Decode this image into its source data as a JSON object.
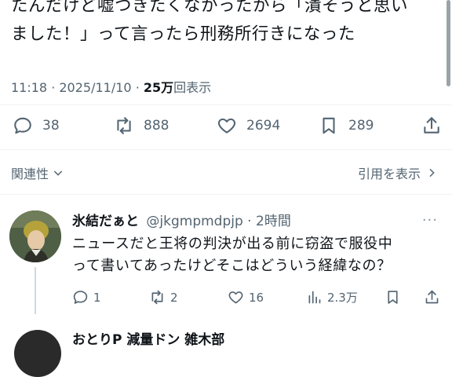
{
  "tweet": {
    "lines": [
      "たんだけど嘘つきたくなかったから「潰そうと思い",
      "ました！」って言ったら刑務所行きになった"
    ],
    "time": "11:18",
    "date": "2025/11/10",
    "views_count": "25万",
    "views_label": "回表示",
    "actions": {
      "replies": "38",
      "retweets": "888",
      "likes": "2694",
      "bookmarks": "289"
    },
    "related_label": "関連性",
    "quotes_label": "引用を表示"
  },
  "reply": {
    "display_name": "氷結だぁと",
    "handle": "@jkgmpmdpjp",
    "time_ago": "2時間",
    "lines": [
      "ニュースだと王将の判決が出る前に窃盗で服役中",
      "って書いてあったけどそこはどういう経緯なの？"
    ],
    "actions": {
      "replies": "1",
      "retweets": "2",
      "likes": "16",
      "views": "2.3万"
    }
  },
  "next_reply": {
    "display_name": "おとりP 減量ドン 雑木部"
  },
  "colors": {
    "text": "#0f1419",
    "secondary": "#536471",
    "divider": "#eff3f4"
  }
}
